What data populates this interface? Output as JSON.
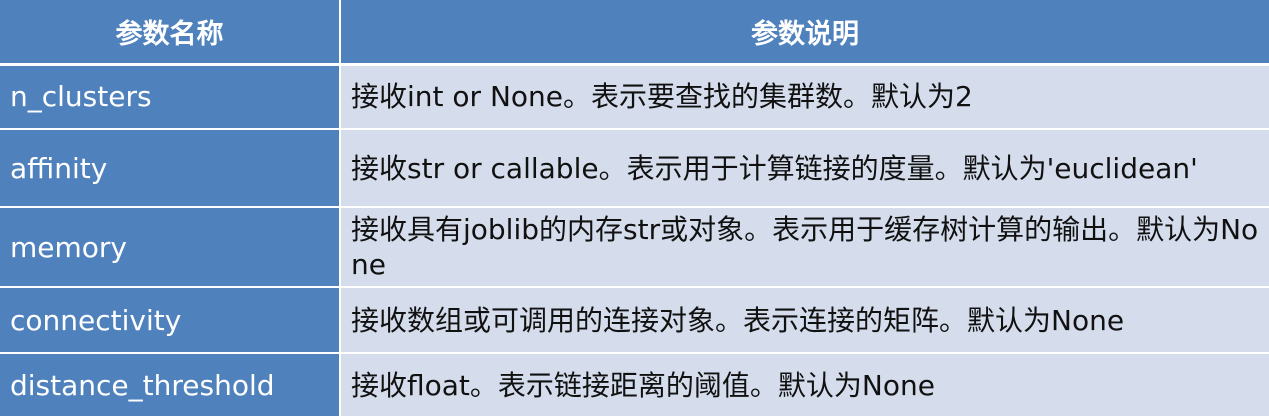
{
  "table": {
    "headers": [
      "参数名称",
      "参数说明"
    ],
    "rows": [
      {
        "name": "n_clusters",
        "description": "接收int or None。表示要查找的集群数。默认为2"
      },
      {
        "name": "affinity",
        "description": "接收str or callable。表示用于计算链接的度量。默认为'euclidean'"
      },
      {
        "name": "memory",
        "description": "接收具有joblib的内存str或对象。表示用于缓存树计算的输出。默认为None"
      },
      {
        "name": "connectivity",
        "description": "接收数组或可调用的连接对象。表示连接的矩阵。默认为None"
      },
      {
        "name": "distance_threshold",
        "description": "接收float。表示链接距离的阈值。默认为None"
      }
    ]
  },
  "colors": {
    "header_bg": "#4f81bd",
    "name_cell_bg": "#4f81bd",
    "desc_cell_bg": "#d5dded",
    "border": "#ffffff"
  }
}
